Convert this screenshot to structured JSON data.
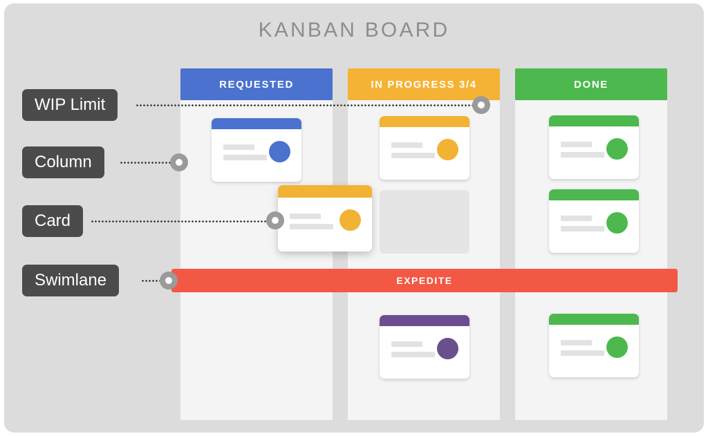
{
  "board": {
    "title": "KANBAN BOARD",
    "background_color": "#dcdcdc",
    "column_background_color": "#f4f4f4",
    "title_color": "#8d8d8d"
  },
  "columns": [
    {
      "id": "requested",
      "header": "REQUESTED",
      "color": "#4a72ce",
      "cards": [
        {
          "accent": "#4a72ce",
          "avatar": "#4a72ce"
        }
      ]
    },
    {
      "id": "in-progress",
      "header": "IN PROGRESS 3/4",
      "color": "#f5b335",
      "wip_limit": "3/4",
      "cards": [
        {
          "accent": "#f2b233",
          "avatar": "#f2b233"
        },
        {
          "accent": "#6b4e8e",
          "avatar": "#6b4e8e"
        }
      ],
      "placeholder_color": "#e5e5e5"
    },
    {
      "id": "done",
      "header": "DONE",
      "color": "#4cb84e",
      "cards": [
        {
          "accent": "#4cb84e",
          "avatar": "#4cb84e"
        },
        {
          "accent": "#4cb84e",
          "avatar": "#4cb84e"
        },
        {
          "accent": "#4cb84e",
          "avatar": "#4cb84e"
        }
      ]
    }
  ],
  "dragged_card": {
    "accent": "#f2b233",
    "avatar": "#f2b233"
  },
  "swimlane": {
    "label": "EXPEDITE",
    "color": "#f25844"
  },
  "annotations": [
    {
      "id": "wip-limit",
      "label": "WIP Limit"
    },
    {
      "id": "column",
      "label": "Column"
    },
    {
      "id": "card",
      "label": "Card"
    },
    {
      "id": "swimlane",
      "label": "Swimlane"
    }
  ],
  "colors": {
    "blue": "#4a72ce",
    "amber": "#f5b335",
    "green": "#4cb84e",
    "purple": "#6b4e8e",
    "red": "#f25844",
    "label_dark": "#4b4b4b",
    "marker_gray": "#9a9a9a",
    "placeholder_line": "#e2e2e2"
  }
}
